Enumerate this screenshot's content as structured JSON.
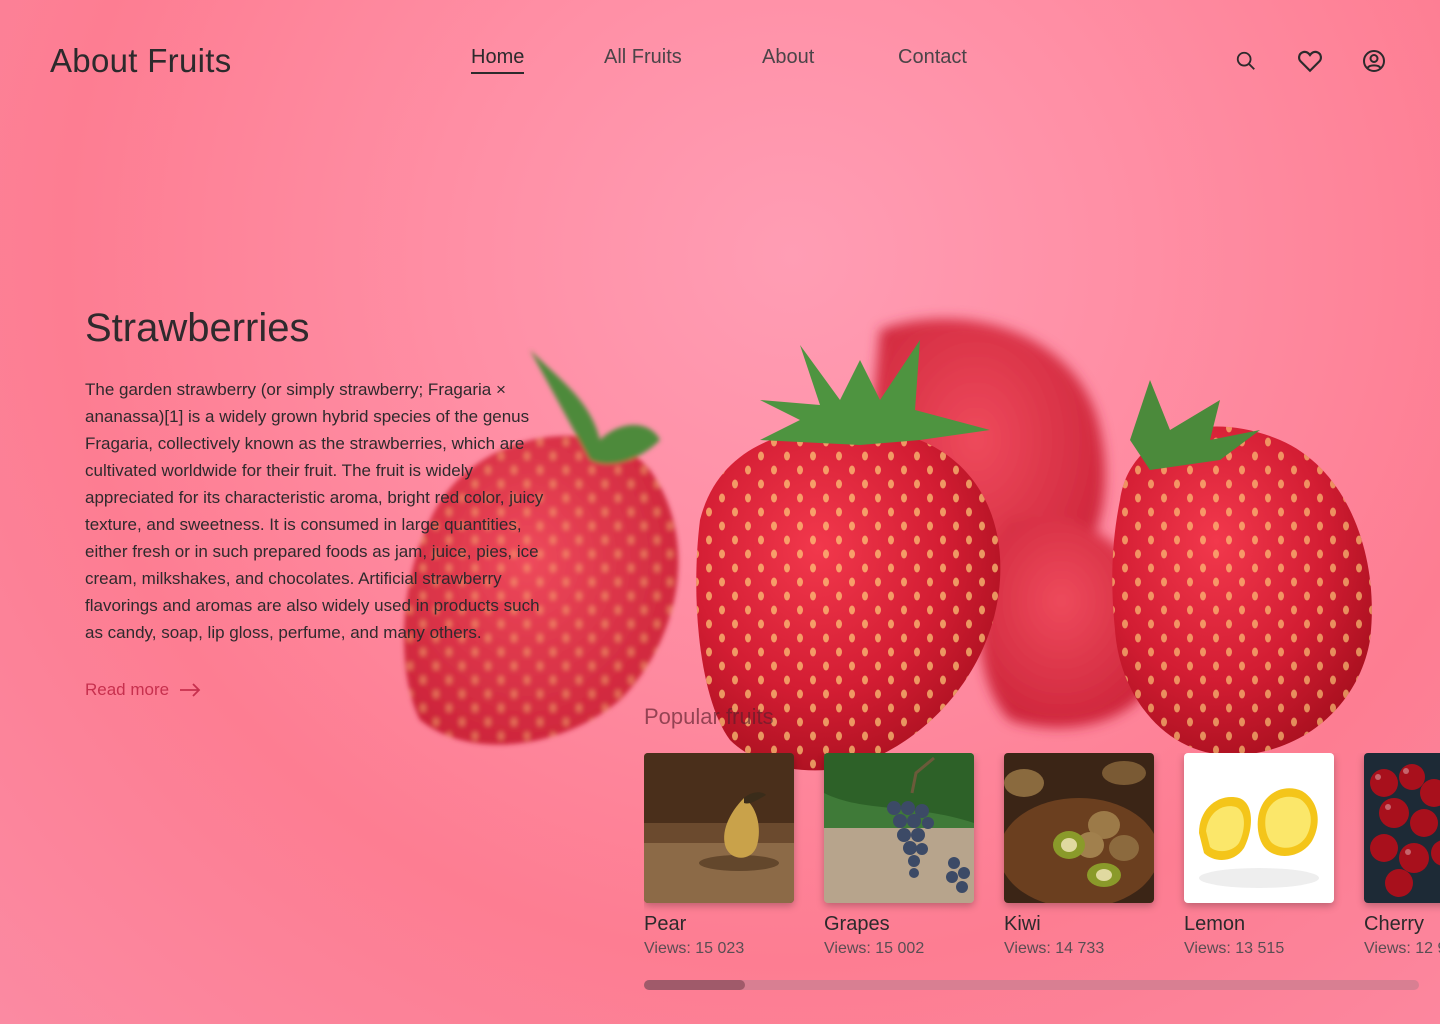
{
  "header": {
    "logo": "About Fruits",
    "nav": [
      {
        "label": "Home",
        "active": true
      },
      {
        "label": "All Fruits",
        "active": false
      },
      {
        "label": "About",
        "active": false
      },
      {
        "label": "Contact",
        "active": false
      }
    ],
    "icons": [
      "search-icon",
      "heart-icon",
      "user-icon"
    ]
  },
  "hero": {
    "title": "Strawberries",
    "description": "The garden strawberry (or simply strawberry; Fragaria × ananassa)[1] is a widely grown hybrid species of the genus Fragaria, collectively known as the strawberries, which are cultivated worldwide for their fruit. The fruit is widely appreciated for its characteristic aroma, bright red color, juicy texture, and sweetness. It is consumed in large quantities, either fresh or in such prepared foods as jam, juice, pies, ice cream, milkshakes, and chocolates. Artificial strawberry flavorings and aromas are also widely used in products such as candy, soap, lip gloss, perfume, and many others.",
    "read_more": "Read more"
  },
  "popular": {
    "title": "Popular fruits",
    "items": [
      {
        "name": "Pear",
        "views": "Views: 15 023"
      },
      {
        "name": "Grapes",
        "views": "Views: 15 002"
      },
      {
        "name": "Kiwi",
        "views": "Views: 14 733"
      },
      {
        "name": "Lemon",
        "views": "Views: 13 515"
      },
      {
        "name": "Cherry",
        "views": "Views: 12 9"
      }
    ],
    "scroll_fraction": 0.13
  },
  "colors": {
    "background": "#ff8fa5",
    "accent": "#c7304e",
    "text": "#2c2a2c"
  }
}
